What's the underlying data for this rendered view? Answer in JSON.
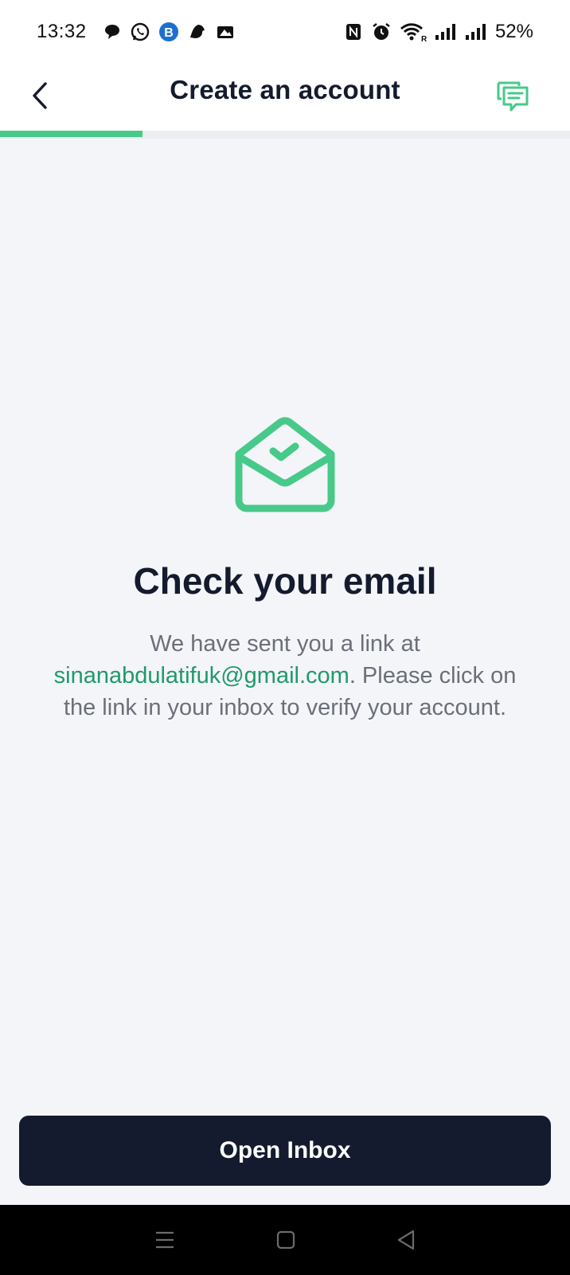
{
  "status_bar": {
    "time": "13:32",
    "battery": "52%",
    "left_icons": [
      "chat-bubble-icon",
      "whatsapp-icon",
      "b-app-icon",
      "bird-app-icon",
      "image-app-icon"
    ],
    "right_icons": [
      "nfc-icon",
      "alarm-icon",
      "wifi-icon",
      "signal-icon",
      "signal-icon"
    ]
  },
  "header": {
    "title": "Create an account",
    "back_icon": "chevron-left-icon",
    "support_icon": "chat-icon",
    "progress": 0.25
  },
  "main": {
    "icon": "mail-open-check-icon",
    "title": "Check your email",
    "message_before": "We have sent you a link at ",
    "email": "sinanabdulatifuk@gmail.com",
    "message_after": ". Please click on the link in your inbox to verify your account."
  },
  "actions": {
    "open_inbox": "Open Inbox"
  },
  "colors": {
    "accent": "#47c98a",
    "email_text": "#1f9a6a",
    "dark": "#141b2e",
    "background": "#f4f5f8"
  },
  "nav_bar": {
    "icons": [
      "menu-icon",
      "home-icon",
      "back-icon"
    ]
  }
}
